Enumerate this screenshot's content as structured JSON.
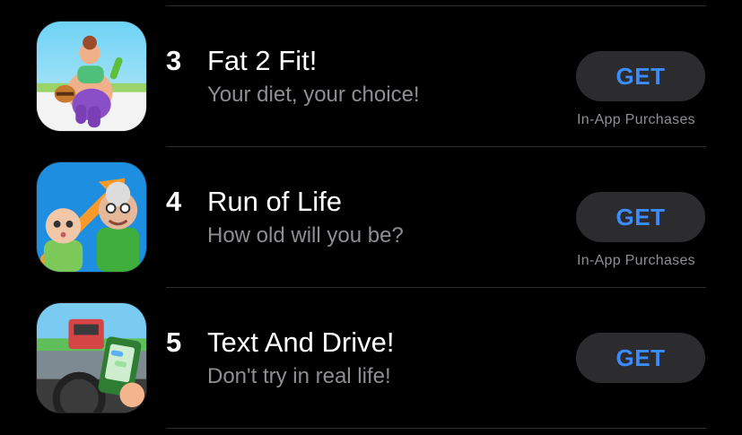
{
  "apps": [
    {
      "rank": "3",
      "name": "Fat 2 Fit!",
      "subtitle": "Your diet, your choice!",
      "button_label": "GET",
      "purchase_note": "In-App Purchases",
      "icon": "fat-2-fit-app-icon"
    },
    {
      "rank": "4",
      "name": "Run of Life",
      "subtitle": "How old will you be?",
      "button_label": "GET",
      "purchase_note": "In-App Purchases",
      "icon": "run-of-life-app-icon"
    },
    {
      "rank": "5",
      "name": "Text And Drive!",
      "subtitle": "Don't try in real life!",
      "button_label": "GET",
      "purchase_note": "",
      "icon": "text-and-drive-app-icon"
    }
  ],
  "colors": {
    "background": "#000000",
    "button_background": "#2c2c2e",
    "button_text": "#3b8dff",
    "secondary_text": "#8e8e93",
    "divider": "#2c2c2e"
  }
}
